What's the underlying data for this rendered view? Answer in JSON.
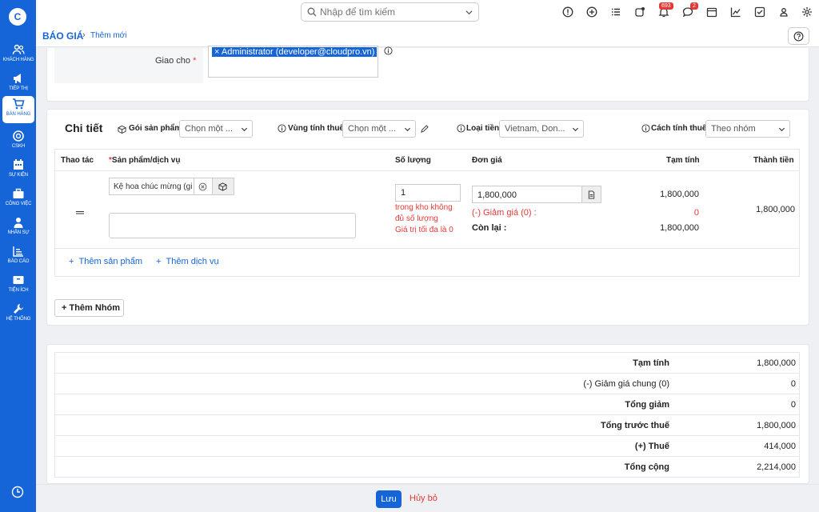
{
  "sidebar": {
    "logo": "C",
    "items": [
      {
        "label": "KHÁCH HÀNG",
        "icon": "users-icon"
      },
      {
        "label": "TIẾP THỊ",
        "icon": "megaphone-icon"
      },
      {
        "label": "BÁN HÀNG",
        "icon": "cart-icon",
        "active": true
      },
      {
        "label": "CSKH",
        "icon": "support-icon"
      },
      {
        "label": "SỰ KIỆN",
        "icon": "calendar-icon"
      },
      {
        "label": "CÔNG VIỆC",
        "icon": "briefcase-icon"
      },
      {
        "label": "NHÂN SỰ",
        "icon": "person-icon"
      },
      {
        "label": "BÁO CÁO",
        "icon": "report-icon"
      },
      {
        "label": "TIỆN ÍCH",
        "icon": "box-icon"
      },
      {
        "label": "HỆ THỐNG",
        "icon": "wrench-icon"
      }
    ]
  },
  "topbar": {
    "search_placeholder": "Nhập để tìm kiếm",
    "notif_count": "693",
    "chat_count": "2"
  },
  "breadcrumb": {
    "main": "BÁO GIÁ",
    "sub": "Thêm mới"
  },
  "assign": {
    "label": "Giao cho",
    "required": "*",
    "tag": "Administrator (developer@cloudpro.vn)",
    "tag_remove": "×"
  },
  "detail": {
    "title": "Chi tiết",
    "package_label": "Gói sản phẩm",
    "package_value": "Chọn một ...",
    "tax_region_label": "Vùng tính thuế",
    "tax_region_value": "Chọn một ...",
    "currency_label": "Loại tiền",
    "currency_value": "Vietnam, Don...",
    "tax_method_label": "Cách tính thuế",
    "tax_method_value": "Theo nhóm"
  },
  "table": {
    "headers": {
      "action": "Thao tác",
      "product_req": "*",
      "product": "Sản phẩm/dịch vụ",
      "qty": "Số lượng",
      "price": "Đơn giá",
      "subtotal": "Tạm tính",
      "total": "Thành tiền"
    },
    "row": {
      "drag": "═",
      "product": "Kệ hoa chúc mừng (gi",
      "qty": "1",
      "warn1": "trong kho không",
      "warn2": "đủ số lượng",
      "warn3": "Giá trị tối đa là 0",
      "price": "1,800,000",
      "discount_label": "(-) Giảm giá (0) :",
      "remaining_label": "Còn lại :",
      "subtotal": "1,800,000",
      "discount": "0",
      "remaining": "1,800,000",
      "total": "1,800,000"
    },
    "add_product": "Thêm sản phẩm",
    "add_service": "Thêm dịch vụ",
    "add_group": "Thêm Nhóm"
  },
  "summary": {
    "rows": [
      {
        "label": "Tạm tính",
        "value": "1,800,000"
      },
      {
        "label": "(-) Giảm giá chung (0)",
        "value": "0"
      },
      {
        "label": "Tổng giảm",
        "value": "0"
      },
      {
        "label": "Tổng trước thuế",
        "value": "1,800,000"
      },
      {
        "label": "(+) Thuế",
        "value": "414,000"
      },
      {
        "label": "Tổng cộng",
        "value": "2,214,000"
      }
    ]
  },
  "footer": {
    "save": "Lưu",
    "cancel": "Hủy bỏ"
  },
  "colors": {
    "primary": "#1565d8",
    "danger": "#e53935"
  }
}
